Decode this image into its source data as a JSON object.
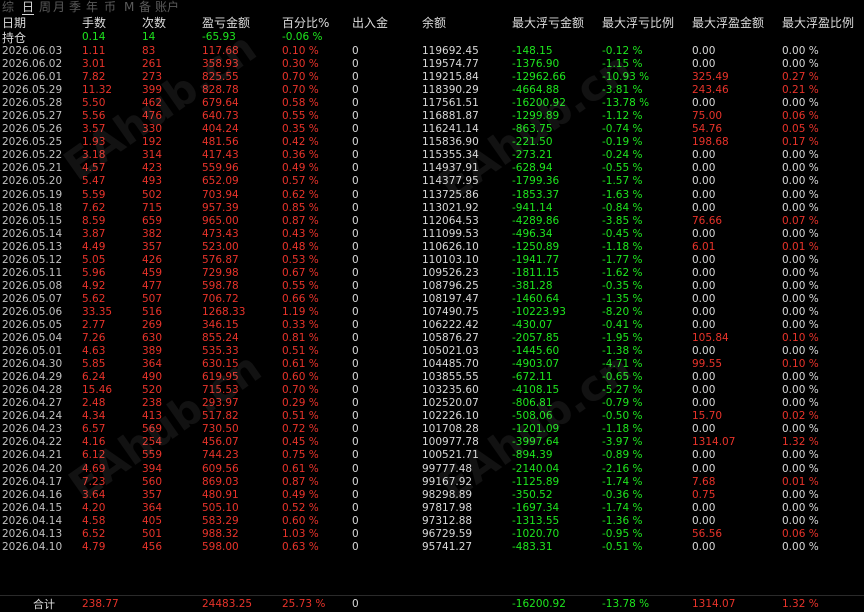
{
  "tabs": [
    "综",
    "日",
    "周",
    "月",
    "季",
    "年",
    "币",
    "M",
    "备",
    "账户"
  ],
  "active_tab": 1,
  "columns": [
    "日期",
    "手数",
    "次数",
    "盈亏金额",
    "百分比%",
    "出入金",
    "余额",
    "最大浮亏金额",
    "最大浮亏比例",
    "最大浮盈金额",
    "最大浮盈比例"
  ],
  "holding": {
    "label": "持仓",
    "lots": "0.14",
    "count": "14",
    "pnl": "-65.93",
    "pct": "-0.06 %"
  },
  "rows": [
    [
      "2026.06.03",
      "1.11",
      "83",
      "117.68",
      "0.10 %",
      "0",
      "119692.45",
      "-148.15",
      "-0.12 %",
      "0.00",
      "0.00 %"
    ],
    [
      "2026.06.02",
      "3.01",
      "261",
      "358.93",
      "0.30 %",
      "0",
      "119574.77",
      "-1376.90",
      "-1.15 %",
      "0.00",
      "0.00 %"
    ],
    [
      "2026.06.01",
      "7.82",
      "273",
      "825.55",
      "0.70 %",
      "0",
      "119215.84",
      "-12962.66",
      "-10.93 %",
      "325.49",
      "0.27 %"
    ],
    [
      "2026.05.29",
      "11.32",
      "399",
      "828.78",
      "0.70 %",
      "0",
      "118390.29",
      "-4664.88",
      "-3.81 %",
      "243.46",
      "0.21 %"
    ],
    [
      "2026.05.28",
      "5.50",
      "462",
      "679.64",
      "0.58 %",
      "0",
      "117561.51",
      "-16200.92",
      "-13.78 %",
      "0.00",
      "0.00 %"
    ],
    [
      "2026.05.27",
      "5.56",
      "476",
      "640.73",
      "0.55 %",
      "0",
      "116881.87",
      "-1299.89",
      "-1.12 %",
      "75.00",
      "0.06 %"
    ],
    [
      "2026.05.26",
      "3.57",
      "330",
      "404.24",
      "0.35 %",
      "0",
      "116241.14",
      "-863.75",
      "-0.74 %",
      "54.76",
      "0.05 %"
    ],
    [
      "2026.05.25",
      "1.93",
      "192",
      "481.56",
      "0.42 %",
      "0",
      "115836.90",
      "-221.50",
      "-0.19 %",
      "198.68",
      "0.17 %"
    ],
    [
      "2026.05.22",
      "3.18",
      "314",
      "417.43",
      "0.36 %",
      "0",
      "115355.34",
      "-273.21",
      "-0.24 %",
      "0.00",
      "0.00 %"
    ],
    [
      "2026.05.21",
      "4.57",
      "423",
      "559.96",
      "0.49 %",
      "0",
      "114937.91",
      "-628.94",
      "-0.55 %",
      "0.00",
      "0.00 %"
    ],
    [
      "2026.05.20",
      "5.47",
      "493",
      "652.09",
      "0.57 %",
      "0",
      "114377.95",
      "-1799.36",
      "-1.57 %",
      "0.00",
      "0.00 %"
    ],
    [
      "2026.05.19",
      "5.59",
      "502",
      "703.94",
      "0.62 %",
      "0",
      "113725.86",
      "-1853.37",
      "-1.63 %",
      "0.00",
      "0.00 %"
    ],
    [
      "2026.05.18",
      "7.62",
      "715",
      "957.39",
      "0.85 %",
      "0",
      "113021.92",
      "-941.14",
      "-0.84 %",
      "0.00",
      "0.00 %"
    ],
    [
      "2026.05.15",
      "8.59",
      "659",
      "965.00",
      "0.87 %",
      "0",
      "112064.53",
      "-4289.86",
      "-3.85 %",
      "76.66",
      "0.07 %"
    ],
    [
      "2026.05.14",
      "3.87",
      "382",
      "473.43",
      "0.43 %",
      "0",
      "111099.53",
      "-496.34",
      "-0.45 %",
      "0.00",
      "0.00 %"
    ],
    [
      "2026.05.13",
      "4.49",
      "357",
      "523.00",
      "0.48 %",
      "0",
      "110626.10",
      "-1250.89",
      "-1.18 %",
      "6.01",
      "0.01 %"
    ],
    [
      "2026.05.12",
      "5.05",
      "426",
      "576.87",
      "0.53 %",
      "0",
      "110103.10",
      "-1941.77",
      "-1.77 %",
      "0.00",
      "0.00 %"
    ],
    [
      "2026.05.11",
      "5.96",
      "459",
      "729.98",
      "0.67 %",
      "0",
      "109526.23",
      "-1811.15",
      "-1.62 %",
      "0.00",
      "0.00 %"
    ],
    [
      "2026.05.08",
      "4.92",
      "477",
      "598.78",
      "0.55 %",
      "0",
      "108796.25",
      "-381.28",
      "-0.35 %",
      "0.00",
      "0.00 %"
    ],
    [
      "2026.05.07",
      "5.62",
      "507",
      "706.72",
      "0.66 %",
      "0",
      "108197.47",
      "-1460.64",
      "-1.35 %",
      "0.00",
      "0.00 %"
    ],
    [
      "2026.05.06",
      "33.35",
      "516",
      "1268.33",
      "1.19 %",
      "0",
      "107490.75",
      "-10223.93",
      "-8.20 %",
      "0.00",
      "0.00 %"
    ],
    [
      "2026.05.05",
      "2.77",
      "269",
      "346.15",
      "0.33 %",
      "0",
      "106222.42",
      "-430.07",
      "-0.41 %",
      "0.00",
      "0.00 %"
    ],
    [
      "2026.05.04",
      "7.26",
      "630",
      "855.24",
      "0.81 %",
      "0",
      "105876.27",
      "-2057.85",
      "-1.95 %",
      "105.84",
      "0.10 %"
    ],
    [
      "2026.05.01",
      "4.63",
      "389",
      "535.33",
      "0.51 %",
      "0",
      "105021.03",
      "-1445.60",
      "-1.38 %",
      "0.00",
      "0.00 %"
    ],
    [
      "2026.04.30",
      "5.85",
      "364",
      "630.15",
      "0.61 %",
      "0",
      "104485.70",
      "-4903.07",
      "-4.71 %",
      "99.55",
      "0.10 %"
    ],
    [
      "2026.04.29",
      "6.24",
      "490",
      "619.95",
      "0.60 %",
      "0",
      "103855.55",
      "-672.11",
      "-0.65 %",
      "0.00",
      "0.00 %"
    ],
    [
      "2026.04.28",
      "15.46",
      "520",
      "715.53",
      "0.70 %",
      "0",
      "103235.60",
      "-4108.15",
      "-5.27 %",
      "0.00",
      "0.00 %"
    ],
    [
      "2026.04.27",
      "2.48",
      "238",
      "293.97",
      "0.29 %",
      "0",
      "102520.07",
      "-806.81",
      "-0.79 %",
      "0.00",
      "0.00 %"
    ],
    [
      "2026.04.24",
      "4.34",
      "413",
      "517.82",
      "0.51 %",
      "0",
      "102226.10",
      "-508.06",
      "-0.50 %",
      "15.70",
      "0.02 %"
    ],
    [
      "2026.04.23",
      "6.57",
      "569",
      "730.50",
      "0.72 %",
      "0",
      "101708.28",
      "-1201.09",
      "-1.18 %",
      "0.00",
      "0.00 %"
    ],
    [
      "2026.04.22",
      "4.16",
      "254",
      "456.07",
      "0.45 %",
      "0",
      "100977.78",
      "-3997.64",
      "-3.97 %",
      "1314.07",
      "1.32 %"
    ],
    [
      "2026.04.21",
      "6.12",
      "559",
      "744.23",
      "0.75 %",
      "0",
      "100521.71",
      "-894.39",
      "-0.89 %",
      "0.00",
      "0.00 %"
    ],
    [
      "2026.04.20",
      "4.69",
      "394",
      "609.56",
      "0.61 %",
      "0",
      "99777.48",
      "-2140.04",
      "-2.16 %",
      "0.00",
      "0.00 %"
    ],
    [
      "2026.04.17",
      "7.23",
      "560",
      "869.03",
      "0.87 %",
      "0",
      "99167.92",
      "-1125.89",
      "-1.74 %",
      "7.68",
      "0.01 %"
    ],
    [
      "2026.04.16",
      "3.64",
      "357",
      "480.91",
      "0.49 %",
      "0",
      "98298.89",
      "-350.52",
      "-0.36 %",
      "0.75",
      "0.00 %"
    ],
    [
      "2026.04.15",
      "4.20",
      "364",
      "505.10",
      "0.52 %",
      "0",
      "97817.98",
      "-1697.34",
      "-1.74 %",
      "0.00",
      "0.00 %"
    ],
    [
      "2026.04.14",
      "4.58",
      "405",
      "583.29",
      "0.60 %",
      "0",
      "97312.88",
      "-1313.55",
      "-1.36 %",
      "0.00",
      "0.00 %"
    ],
    [
      "2026.04.13",
      "6.52",
      "501",
      "988.32",
      "1.03 %",
      "0",
      "96729.59",
      "-1020.70",
      "-0.95 %",
      "56.56",
      "0.06 %"
    ],
    [
      "2026.04.10",
      "4.79",
      "456",
      "598.00",
      "0.63 %",
      "0",
      "95741.27",
      "-483.31",
      "-0.51 %",
      "0.00",
      "0.00 %"
    ]
  ],
  "total": {
    "label": "合计",
    "lots": "238.77",
    "pnl": "24483.25",
    "pct": "25.73 %",
    "cash": "0",
    "dd": "-16200.92",
    "dd_pct": "-13.78 %",
    "fp": "1314.07",
    "fp_pct": "1.32 %"
  },
  "watermark": "EAhub.cn",
  "colors": {
    "profit": "#e8332a",
    "loss": "#1ee61e",
    "neutral": "#d8d8d8",
    "background": "#000000"
  }
}
